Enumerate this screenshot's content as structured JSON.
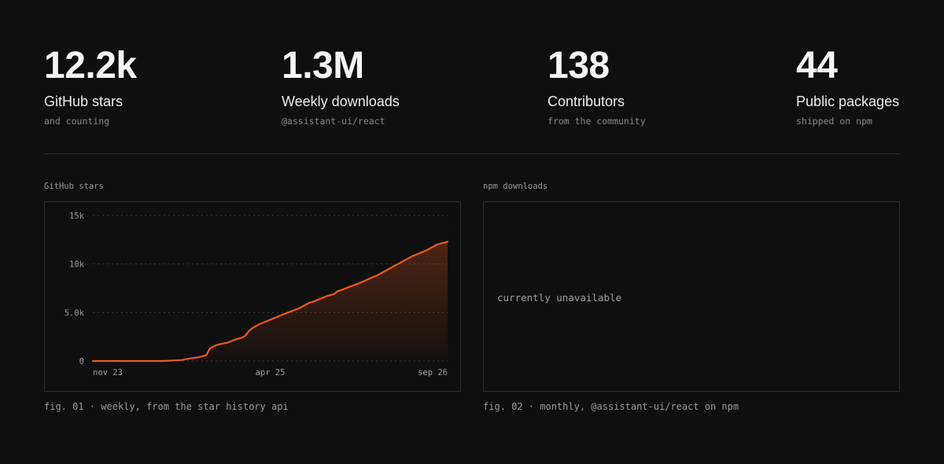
{
  "stats": [
    {
      "value": "12.2k",
      "label": "GitHub stars",
      "sub": "and counting"
    },
    {
      "value": "1.3M",
      "label": "Weekly downloads",
      "sub": "@assistant-ui/react"
    },
    {
      "value": "138",
      "label": "Contributors",
      "sub": "from the community"
    },
    {
      "value": "44",
      "label": "Public packages",
      "sub": "shipped on npm"
    }
  ],
  "stars_panel": {
    "title": "GitHub stars",
    "caption": "fig. 01 · weekly, from the star history api"
  },
  "npm_panel": {
    "title": "npm downloads",
    "message": "currently unavailable",
    "caption": "fig. 02 · monthly, @assistant-ui/react on npm"
  },
  "colors": {
    "line": "#ee5a1c",
    "background": "#0f0f0f"
  },
  "chart_data": {
    "type": "area",
    "title": "GitHub stars",
    "xlabel": "",
    "ylabel": "",
    "ylim": [
      0,
      15000
    ],
    "yticks": [
      0,
      5000,
      10000,
      15000
    ],
    "ytick_labels": [
      "0",
      "5.0k",
      "10k",
      "15k"
    ],
    "x_tick_labels": [
      "nov 23",
      "apr 25",
      "sep 26"
    ],
    "x_tick_positions": [
      0,
      0.5,
      1
    ],
    "grid": true,
    "series": [
      {
        "x": [
          0,
          0.1,
          0.2,
          0.25,
          0.28,
          0.3,
          0.32,
          0.33,
          0.34,
          0.35,
          0.36,
          0.38,
          0.4,
          0.41,
          0.42,
          0.43,
          0.44,
          0.45,
          0.47,
          0.49,
          0.51,
          0.53,
          0.55,
          0.58,
          0.6,
          0.61,
          0.62,
          0.64,
          0.66,
          0.68,
          0.69,
          0.7,
          0.72,
          0.75,
          0.78,
          0.8,
          0.83,
          0.85,
          0.87,
          0.88,
          0.9,
          0.92,
          0.94,
          0.96,
          0.97,
          0.99,
          1
        ],
        "y": [
          0,
          0,
          0,
          100,
          300,
          400,
          600,
          1300,
          1500,
          1650,
          1750,
          1900,
          2200,
          2300,
          2400,
          2600,
          3100,
          3400,
          3800,
          4100,
          4400,
          4700,
          5000,
          5400,
          5800,
          6000,
          6100,
          6400,
          6700,
          6900,
          7200,
          7300,
          7600,
          8000,
          8500,
          8800,
          9400,
          9800,
          10200,
          10400,
          10800,
          11100,
          11400,
          11800,
          12000,
          12200,
          12300
        ]
      }
    ]
  }
}
